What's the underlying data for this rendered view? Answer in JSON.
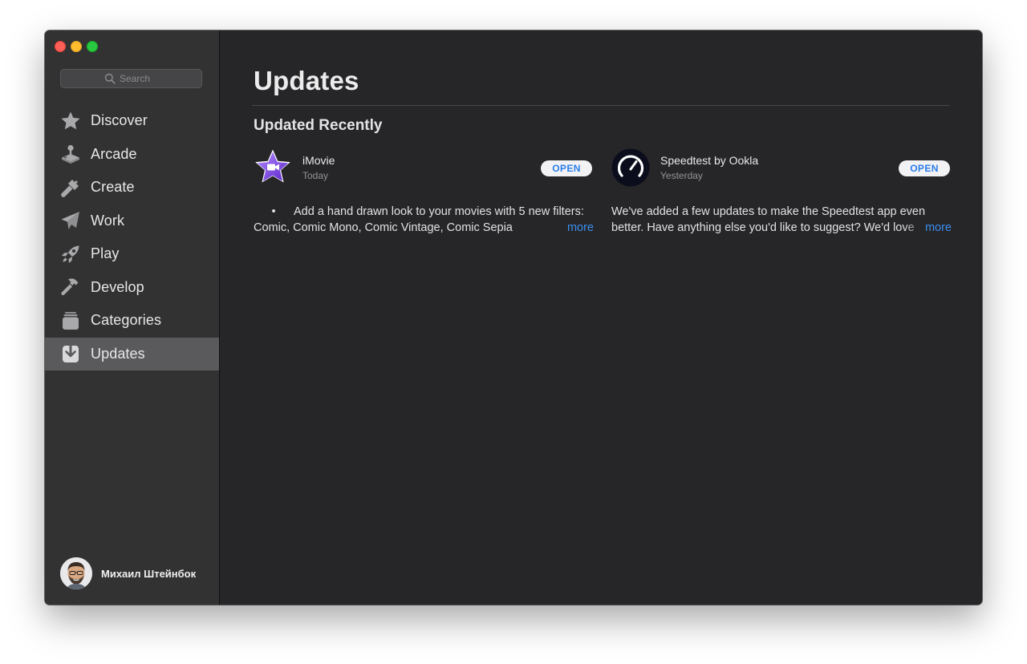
{
  "window": {
    "search": {
      "placeholder": "Search"
    }
  },
  "sidebar": {
    "items": [
      {
        "label": "Discover",
        "icon": "star-icon"
      },
      {
        "label": "Arcade",
        "icon": "joystick-icon"
      },
      {
        "label": "Create",
        "icon": "brush-icon"
      },
      {
        "label": "Work",
        "icon": "paper-plane-icon"
      },
      {
        "label": "Play",
        "icon": "rocket-icon"
      },
      {
        "label": "Develop",
        "icon": "hammer-icon"
      },
      {
        "label": "Categories",
        "icon": "stack-icon"
      },
      {
        "label": "Updates",
        "icon": "download-tray-icon",
        "active": true
      }
    ],
    "user": {
      "name": "Михаил Штейнбок"
    }
  },
  "main": {
    "title": "Updates",
    "section_title": "Updated Recently",
    "apps": [
      {
        "name": "iMovie",
        "date": "Today",
        "button": "OPEN",
        "bullet": "•",
        "notes": "Add a hand drawn look to your movies with 5 new filters: Comic, Comic Mono, Comic Vintage, Comic Sepia",
        "more": "more"
      },
      {
        "name": "Speedtest by Ookla",
        "date": "Yesterday",
        "button": "OPEN",
        "notes": "We've added a few updates to make the Speedtest app even better. Have anything else you'd like to suggest? We'd love",
        "more": "more"
      }
    ]
  },
  "colors": {
    "accent": "#2b7de9",
    "sidebar_bg": "#323233",
    "main_bg": "#262628",
    "active_item": "#5a5a5c"
  }
}
